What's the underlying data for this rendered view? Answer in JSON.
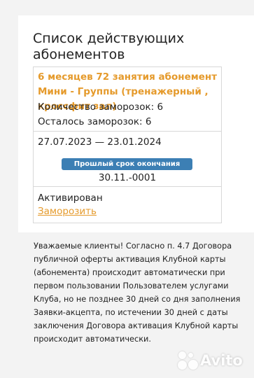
{
  "page": {
    "title": "Список действующих абонементов"
  },
  "subscription": {
    "plan_name": "6 месяцев 72 занятия абонемент Мини - Группы (тренажерный , кроссфит зал)",
    "freeze_count_label": "Количество заморозок: 6",
    "freeze_left_label": "Осталось заморозок: 6",
    "dates": "27.07.2023 — 23.01.2024",
    "expired_badge": "Прошлый срок окончания абонемента",
    "previous_end_date": "30.11.-0001",
    "status": "Активирован",
    "freeze_link": "Заморозить"
  },
  "notice": {
    "text": "Уважаемые клиенты! Согласно п. 4.7 Договора публичной оферты активация Клубной карты (абонемента) происходит автоматически при первом пользовании Пользователем услугами Клуба, но не позднее 30 дней со дня заполнения Заявки-акцепта, по истечении 30 дней с даты заключения Договора активация Клубной карты происходит автоматически."
  },
  "watermark": {
    "text": "Avito"
  },
  "colors": {
    "accent_orange": "#e59a2b",
    "badge_blue": "#3c7fb4",
    "background": "#f3f3f3"
  }
}
